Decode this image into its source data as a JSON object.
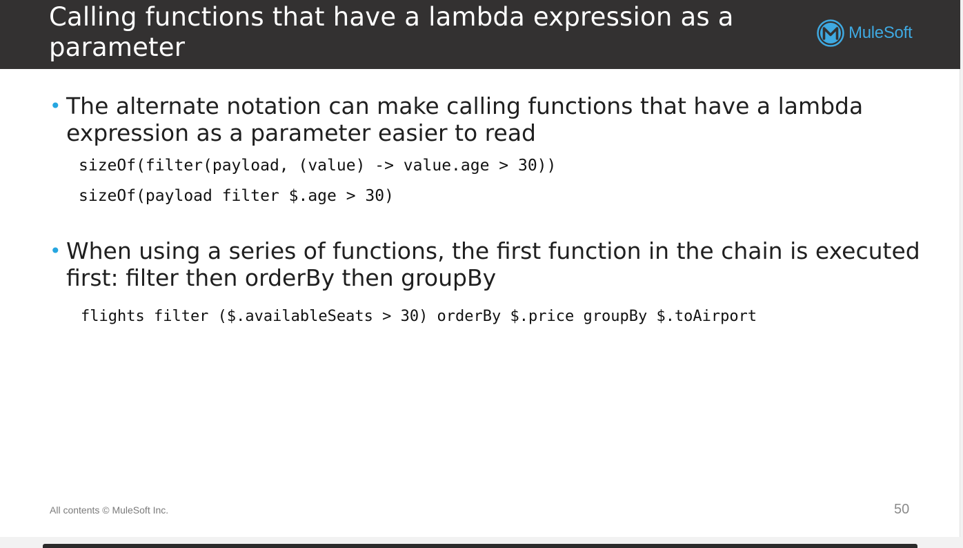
{
  "slide": {
    "title": "Calling functions that have a lambda expression as a parameter",
    "logo": {
      "text": "MuleSoft",
      "icon": "mulesoft-logo-icon",
      "color": "#3fa9e1"
    },
    "bullets": [
      {
        "text": "The alternate notation can make calling functions that have a lambda expression as a parameter easier to read",
        "code": [
          "sizeOf(filter(payload, (value) -> value.age > 30))",
          "sizeOf(payload filter $.age > 30)"
        ]
      },
      {
        "text": "When using a series of functions, the first function in the chain is executed first: filter then orderBy then groupBy",
        "code": [
          "flights filter ($.availableSeats > 30) orderBy $.price groupBy $.toAirport"
        ]
      }
    ],
    "footer": "All contents © MuleSoft Inc.",
    "page_number": "50",
    "colors": {
      "title_bar": "#333131",
      "bullet": "#26a6e0"
    }
  }
}
